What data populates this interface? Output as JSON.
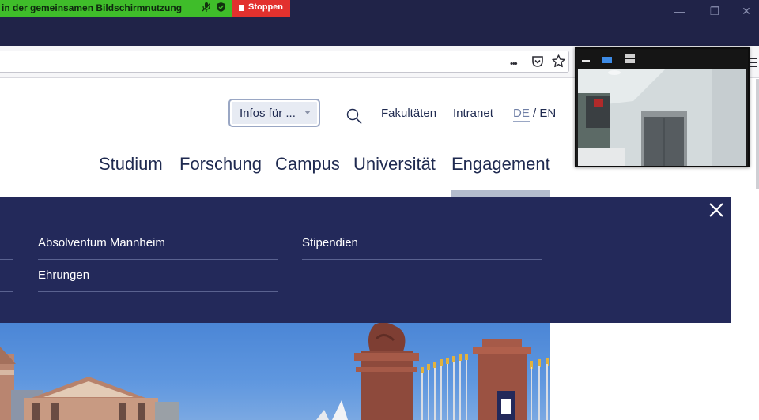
{
  "window": {
    "share_banner_text": "in der gemeinsamen Bildschirmnutzung",
    "stop_label": "Stoppen",
    "minimize_glyph": "—",
    "restore_glyph": "❐",
    "close_glyph": "✕"
  },
  "toolbar": {
    "more_glyph": "•••",
    "pocket_icon": "pocket-icon",
    "bookmark_icon": "star-icon",
    "menu_glyph": "☰"
  },
  "header": {
    "infos_select": "Infos für ...",
    "util_links": [
      "Fakultäten",
      "Intranet"
    ],
    "lang": {
      "de": "DE",
      "sep": " / ",
      "en": "EN"
    }
  },
  "main_nav": [
    "Studium",
    "Forschung",
    "Campus",
    "Universität",
    "Engagement"
  ],
  "mega_menu": {
    "col1": [
      "Absolventum Mannheim",
      "Ehrungen"
    ],
    "col2": [
      "Stipendien"
    ]
  },
  "colors": {
    "navy": "#23295a",
    "text": "#1f2a50",
    "share_green": "#3fbd2a",
    "stop_red": "#e2312e"
  }
}
